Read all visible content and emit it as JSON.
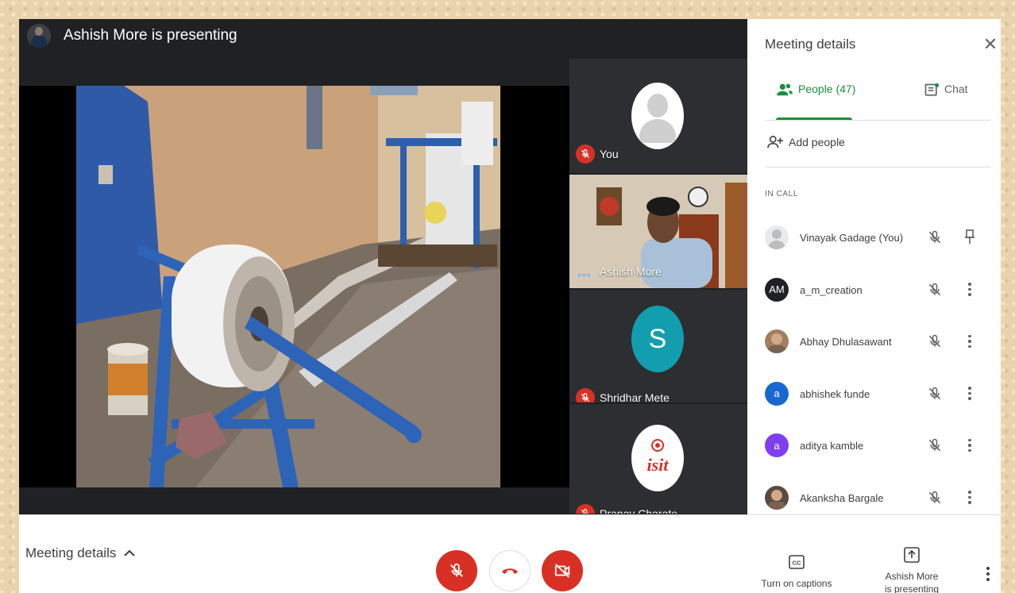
{
  "presenter_bar": {
    "title": "Ashish More is presenting"
  },
  "tiles": [
    {
      "name": "You",
      "muted": true
    },
    {
      "name": "Ashish More",
      "speaking": true
    },
    {
      "name": "Shridhar Mete",
      "initial": "S",
      "muted": true
    },
    {
      "name": "Pranav Charate",
      "muted": true,
      "logo_text": "isit"
    }
  ],
  "panel": {
    "title": "Meeting details",
    "tabs": {
      "people": "People (47)",
      "chat": "Chat"
    },
    "add_people": "Add people",
    "section_label": "IN CALL",
    "people": [
      {
        "name": "Vinayak Gadage (You)",
        "initial": "",
        "color": "#e8eaed",
        "action": "pin"
      },
      {
        "name": "a_m_creation",
        "initial": "AM",
        "color": "#202124",
        "action": "more"
      },
      {
        "name": "Abhay Dhulasawant",
        "initial": "",
        "color": "#a08060",
        "action": "more"
      },
      {
        "name": "abhishek funde",
        "initial": "a",
        "color": "#1967d2",
        "action": "more"
      },
      {
        "name": "aditya kamble",
        "initial": "a",
        "color": "#7e3ff2",
        "action": "more"
      },
      {
        "name": "Akanksha Bargale",
        "initial": "",
        "color": "#5a4a40",
        "action": "more"
      }
    ]
  },
  "bottom_bar": {
    "meeting_details": "Meeting details",
    "captions": "Turn on captions",
    "present_line1": "Ashish More",
    "present_line2": "is presenting"
  },
  "colors": {
    "accent_green": "#1e8e3e",
    "danger_red": "#d93025",
    "dark_bg": "#202124"
  }
}
